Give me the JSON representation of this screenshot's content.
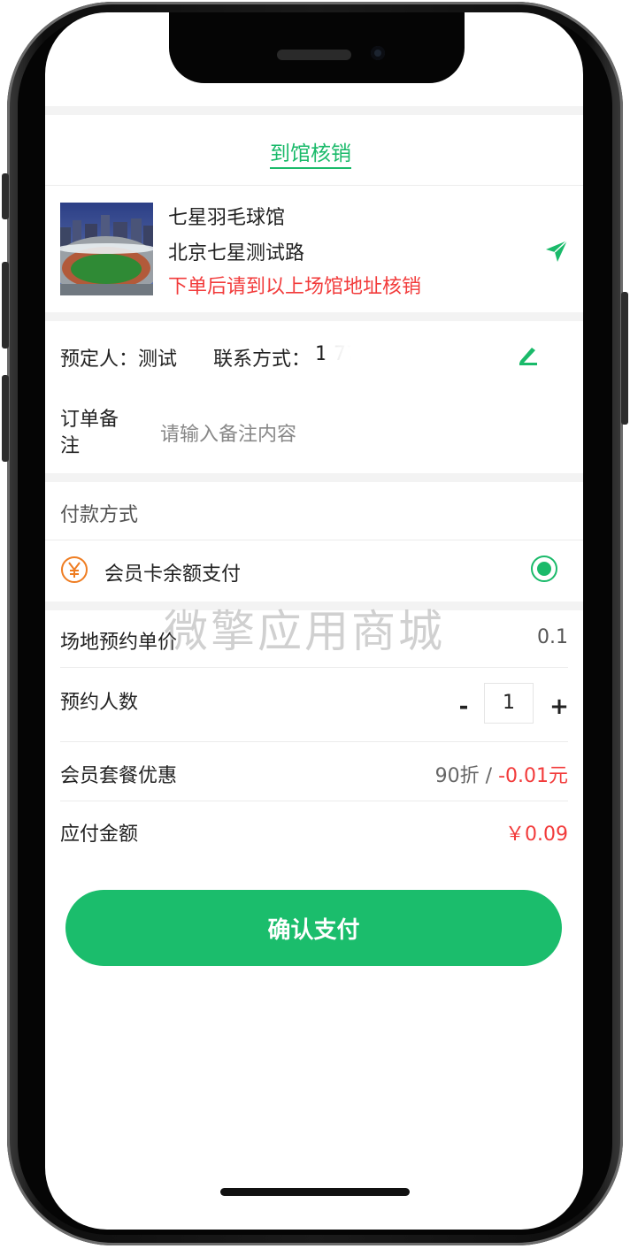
{
  "header": {
    "title": "到馆核销"
  },
  "venue": {
    "name": "七星羽毛球馆",
    "address": "北京七星测试路",
    "note": "下单后请到以上场馆地址核销",
    "image": "stadium-photo"
  },
  "booking": {
    "booker_label": "预定人：",
    "booker_name": "测试",
    "contact_label": "联系方式：",
    "contact_value": "1          77"
  },
  "remark": {
    "label": "订单备注",
    "placeholder": "请输入备注内容"
  },
  "payment": {
    "section_title": "付款方式",
    "method_label": "会员卡余额支付",
    "selected": true
  },
  "pricing": {
    "unit_price_label": "场地预约单价",
    "unit_price": "0.1",
    "people_label": "预约人数",
    "minus": "-",
    "quantity": "1",
    "plus": "+",
    "discount_label": "会员套餐优惠",
    "discount_rate": "90折",
    "discount_sep": "/",
    "discount_amount": "-0.01元",
    "payable_label": "应付金额",
    "payable_amount": "￥0.09"
  },
  "watermark": "微擎应用商城",
  "actions": {
    "confirm_label": "确认支付"
  },
  "colors": {
    "accent": "#1aba6a",
    "danger": "#f23b3b",
    "button": "#1bbd6c"
  }
}
